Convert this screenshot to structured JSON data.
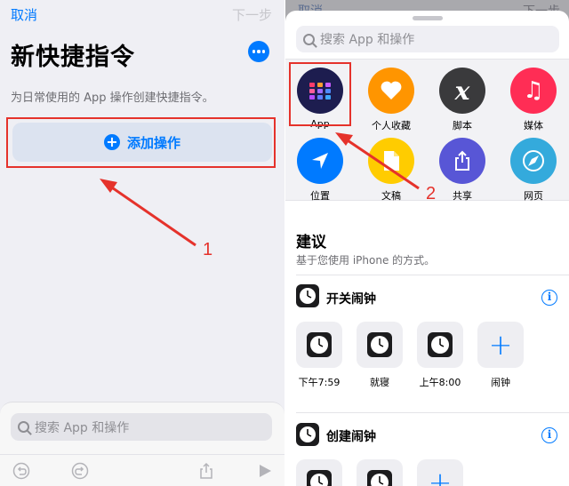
{
  "left": {
    "nav": {
      "cancel": "取消",
      "next": "下一步"
    },
    "title": "新快捷指令",
    "subtitle": "为日常使用的 App 操作创建快捷指令。",
    "add_action": "添加操作",
    "annotation": "1",
    "search": {
      "placeholder": "搜索 App 和操作"
    }
  },
  "right": {
    "nav": {
      "cancel": "取消",
      "next": "下一步"
    },
    "search": {
      "placeholder": "搜索 App 和操作"
    },
    "categories": [
      {
        "label": "App",
        "color": "#1d1d4f",
        "icon": "apps-grid-icon"
      },
      {
        "label": "个人收藏",
        "color": "#ff9500",
        "icon": "heart-icon"
      },
      {
        "label": "脚本",
        "color": "#3a3a3c",
        "icon": "script-x-icon"
      },
      {
        "label": "媒体",
        "color": "#ff2d55",
        "icon": "music-note-icon"
      },
      {
        "label": "位置",
        "color": "#007aff",
        "icon": "location-arrow-icon"
      },
      {
        "label": "文稿",
        "color": "#ffcc00",
        "icon": "document-icon"
      },
      {
        "label": "共享",
        "color": "#5856d6",
        "icon": "share-icon"
      },
      {
        "label": "网页",
        "color": "#34aadc",
        "icon": "compass-icon"
      }
    ],
    "annotation": "2",
    "suggestions": {
      "title": "建议",
      "subtitle": "基于您使用 iPhone 的方式。",
      "groups": [
        {
          "title": "开关闹钟",
          "items": [
            "下午7:59",
            "就寝",
            "上午8:00",
            "闹钟"
          ]
        },
        {
          "title": "创建闹钟",
          "items": [
            "",
            "",
            ""
          ]
        }
      ]
    }
  }
}
